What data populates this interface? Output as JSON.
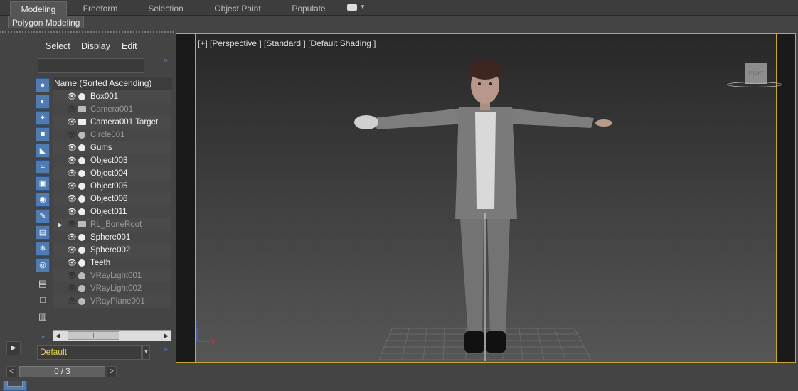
{
  "ribbon": {
    "tabs": [
      "Modeling",
      "Freeform",
      "Selection",
      "Object Paint",
      "Populate"
    ]
  },
  "subbar": {
    "polygon_modeling": "Polygon Modeling"
  },
  "scene_explorer": {
    "menus": [
      "Select",
      "Display",
      "Edit"
    ],
    "column_header": "Name (Sorted Ascending)",
    "items": [
      {
        "name": "Box001",
        "visible": true,
        "icon": "sphere-icon"
      },
      {
        "name": "Camera001",
        "visible": false,
        "icon": "camera-icon"
      },
      {
        "name": "Camera001.Target",
        "visible": true,
        "icon": "camera-icon"
      },
      {
        "name": "Circle001",
        "visible": false,
        "icon": "shape-icon"
      },
      {
        "name": "Gums",
        "visible": true,
        "icon": "sphere-icon"
      },
      {
        "name": "Object003",
        "visible": true,
        "icon": "sphere-icon"
      },
      {
        "name": "Object004",
        "visible": true,
        "icon": "sphere-icon"
      },
      {
        "name": "Object005",
        "visible": true,
        "icon": "sphere-icon"
      },
      {
        "name": "Object006",
        "visible": true,
        "icon": "sphere-icon"
      },
      {
        "name": "Object011",
        "visible": true,
        "icon": "sphere-icon"
      },
      {
        "name": "RL_BoneRoot",
        "visible": false,
        "icon": "bone-icon"
      },
      {
        "name": "Sphere001",
        "visible": true,
        "icon": "sphere-icon"
      },
      {
        "name": "Sphere002",
        "visible": true,
        "icon": "sphere-icon"
      },
      {
        "name": "Teeth",
        "visible": true,
        "icon": "sphere-icon"
      },
      {
        "name": "VRayLight001",
        "visible": false,
        "icon": "light-icon"
      },
      {
        "name": "VRayLight002",
        "visible": false,
        "icon": "light-icon"
      },
      {
        "name": "VRayPlane001",
        "visible": false,
        "icon": "sphere-icon"
      }
    ],
    "layer": "Default",
    "scroll_thumb": "|||"
  },
  "viewport": {
    "label": "[+] [Perspective ] [Standard ] [Default Shading ]",
    "viewcube_face": "FRONT",
    "axis_z": "z",
    "axis_x": "x"
  },
  "timeline": {
    "frame": "0 / 3"
  },
  "colors": {
    "accent": "#c8a830",
    "tool_blue": "#4f7bb3",
    "layer_text": "#e8d84a"
  }
}
